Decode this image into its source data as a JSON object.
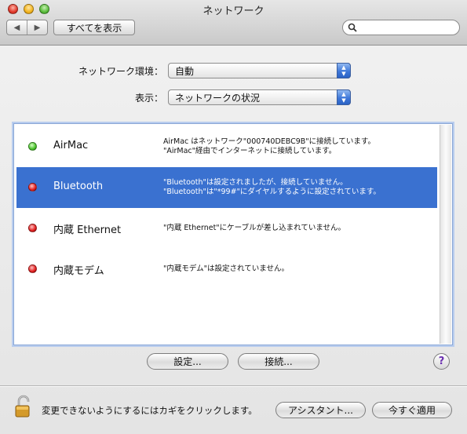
{
  "window": {
    "title": "ネットワーク"
  },
  "toolbar": {
    "back_label": "◀",
    "forward_label": "▶",
    "show_all_label": "すべてを表示",
    "search_value": "",
    "search_placeholder": ""
  },
  "location": {
    "label": "ネットワーク環境：",
    "value": "自動"
  },
  "show": {
    "label": "表示：",
    "value": "ネットワークの状況"
  },
  "services": [
    {
      "name": "AirMac",
      "status": "green",
      "desc_line1": "AirMac はネットワーク\"000740DEBC9B\"に接続しています。",
      "desc_line2": "\"AirMac\"経由でインターネットに接続しています。"
    },
    {
      "name": "Bluetooth",
      "status": "red",
      "selected": true,
      "desc_line1": "\"Bluetooth\"は設定されましたが、接続していません。",
      "desc_line2": "\"Bluetooth\"は\"*99#\"にダイヤルするように設定されています。"
    },
    {
      "name": "内蔵 Ethernet",
      "status": "red",
      "desc_line1": "\"内蔵 Ethernet\"にケーブルが差し込まれていません。",
      "desc_line2": ""
    },
    {
      "name": "内蔵モデム",
      "status": "red",
      "desc_line1": "\"内蔵モデム\"は設定されていません。",
      "desc_line2": ""
    }
  ],
  "buttons": {
    "configure": "設定...",
    "connect": "接続...",
    "help": "?",
    "assistant": "アシスタント...",
    "apply_now": "今すぐ適用"
  },
  "lock": {
    "message": "変更できないようにするにはカギをクリックします。"
  },
  "colors": {
    "selection": "#3a71d0",
    "status_green": "#48c22a",
    "status_red": "#e21c1c"
  }
}
